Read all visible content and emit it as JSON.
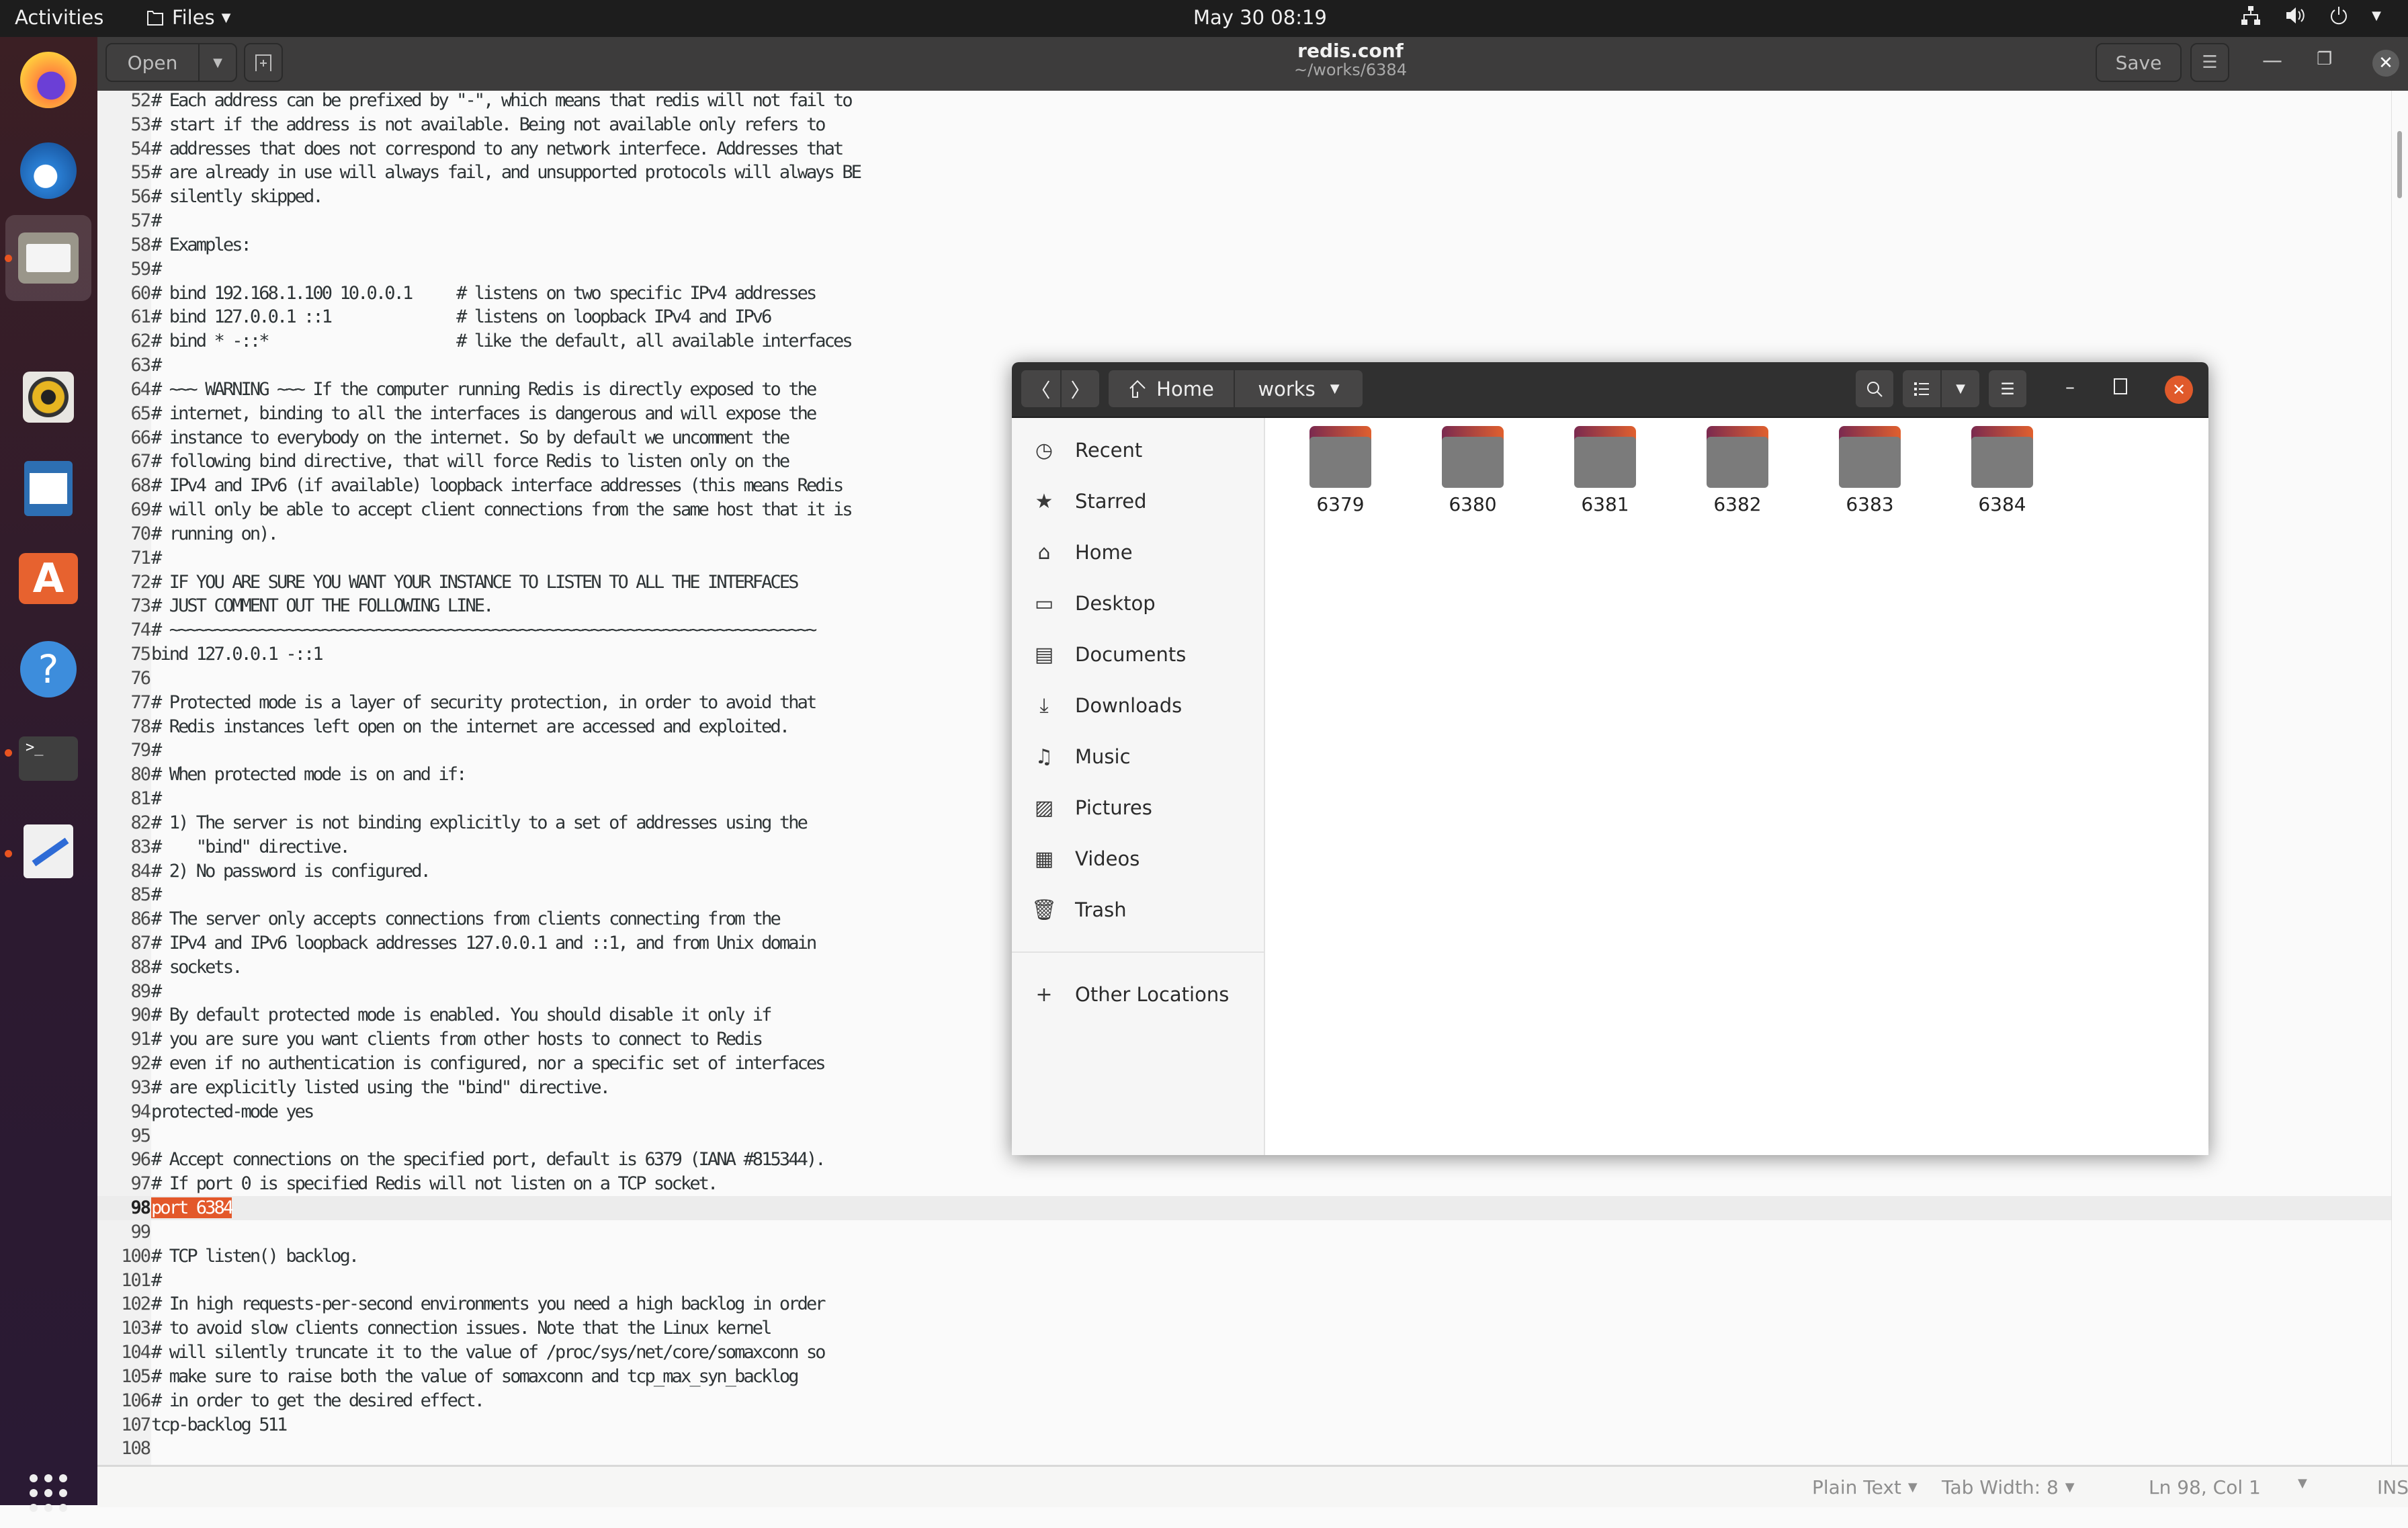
{
  "topbar": {
    "activities": "Activities",
    "app_menu": "Files",
    "clock": "May 30  08:19",
    "tray_icons": [
      "network-icon",
      "volume-icon",
      "power-icon",
      "system-menu-caret"
    ]
  },
  "dock": {
    "apps": [
      {
        "name": "Firefox",
        "icon": "firefox-icon",
        "running": false
      },
      {
        "name": "Thunderbird",
        "icon": "thunderbird-icon",
        "running": false
      },
      {
        "name": "Files",
        "icon": "files-icon",
        "running": true,
        "active": true
      },
      {
        "name": "Rhythmbox",
        "icon": "rhythmbox-icon",
        "running": false
      },
      {
        "name": "LibreOffice Writer",
        "icon": "writer-icon",
        "running": false
      },
      {
        "name": "Ubuntu Software",
        "icon": "software-icon",
        "running": false
      },
      {
        "name": "Help",
        "icon": "help-icon",
        "running": false
      },
      {
        "name": "Terminal",
        "icon": "terminal-icon",
        "running": true
      },
      {
        "name": "Text Editor",
        "icon": "text-editor-icon",
        "running": true
      }
    ],
    "show_apps": "show-applications-icon"
  },
  "gedit": {
    "open_label": "Open",
    "save_label": "Save",
    "title": "redis.conf",
    "subtitle": "~/works/6384",
    "current_line": 98,
    "selected_text": "port 6384",
    "lines": [
      {
        "n": "52",
        "t": "# Each address can be prefixed by \"-\", which means that redis will not fail to"
      },
      {
        "n": "53",
        "t": "# start if the address is not available. Being not available only refers to"
      },
      {
        "n": "54",
        "t": "# addresses that does not correspond to any network interfece. Addresses that"
      },
      {
        "n": "55",
        "t": "# are already in use will always fail, and unsupported protocols will always BE"
      },
      {
        "n": "56",
        "t": "# silently skipped."
      },
      {
        "n": "57",
        "t": "#"
      },
      {
        "n": "58",
        "t": "# Examples:"
      },
      {
        "n": "59",
        "t": "#"
      },
      {
        "n": "60",
        "t": "# bind 192.168.1.100 10.0.0.1     # listens on two specific IPv4 addresses"
      },
      {
        "n": "61",
        "t": "# bind 127.0.0.1 ::1              # listens on loopback IPv4 and IPv6"
      },
      {
        "n": "62",
        "t": "# bind * -::*                     # like the default, all available interfaces"
      },
      {
        "n": "63",
        "t": "#"
      },
      {
        "n": "64",
        "t": "# ~~~ WARNING ~~~ If the computer running Redis is directly exposed to the"
      },
      {
        "n": "65",
        "t": "# internet, binding to all the interfaces is dangerous and will expose the"
      },
      {
        "n": "66",
        "t": "# instance to everybody on the internet. So by default we uncomment the"
      },
      {
        "n": "67",
        "t": "# following bind directive, that will force Redis to listen only on the"
      },
      {
        "n": "68",
        "t": "# IPv4 and IPv6 (if available) loopback interface addresses (this means Redis"
      },
      {
        "n": "69",
        "t": "# will only be able to accept client connections from the same host that it is"
      },
      {
        "n": "70",
        "t": "# running on)."
      },
      {
        "n": "71",
        "t": "#"
      },
      {
        "n": "72",
        "t": "# IF YOU ARE SURE YOU WANT YOUR INSTANCE TO LISTEN TO ALL THE INTERFACES"
      },
      {
        "n": "73",
        "t": "# JUST COMMENT OUT THE FOLLOWING LINE."
      },
      {
        "n": "74",
        "t": "# ~~~~~~~~~~~~~~~~~~~~~~~~~~~~~~~~~~~~~~~~~~~~~~~~~~~~~~~~~~~~~~~~~~~~~~~~"
      },
      {
        "n": "75",
        "t": "bind 127.0.0.1 -::1"
      },
      {
        "n": "76",
        "t": ""
      },
      {
        "n": "77",
        "t": "# Protected mode is a layer of security protection, in order to avoid that"
      },
      {
        "n": "78",
        "t": "# Redis instances left open on the internet are accessed and exploited."
      },
      {
        "n": "79",
        "t": "#"
      },
      {
        "n": "80",
        "t": "# When protected mode is on and if:"
      },
      {
        "n": "81",
        "t": "#"
      },
      {
        "n": "82",
        "t": "# 1) The server is not binding explicitly to a set of addresses using the"
      },
      {
        "n": "83",
        "t": "#    \"bind\" directive."
      },
      {
        "n": "84",
        "t": "# 2) No password is configured."
      },
      {
        "n": "85",
        "t": "#"
      },
      {
        "n": "86",
        "t": "# The server only accepts connections from clients connecting from the"
      },
      {
        "n": "87",
        "t": "# IPv4 and IPv6 loopback addresses 127.0.0.1 and ::1, and from Unix domain"
      },
      {
        "n": "88",
        "t": "# sockets."
      },
      {
        "n": "89",
        "t": "#"
      },
      {
        "n": "90",
        "t": "# By default protected mode is enabled. You should disable it only if"
      },
      {
        "n": "91",
        "t": "# you are sure you want clients from other hosts to connect to Redis"
      },
      {
        "n": "92",
        "t": "# even if no authentication is configured, nor a specific set of interfaces"
      },
      {
        "n": "93",
        "t": "# are explicitly listed using the \"bind\" directive."
      },
      {
        "n": "94",
        "t": "protected-mode yes"
      },
      {
        "n": "95",
        "t": ""
      },
      {
        "n": "96",
        "t": "# Accept connections on the specified port, default is 6379 (IANA #815344)."
      },
      {
        "n": "97",
        "t": "# If port 0 is specified Redis will not listen on a TCP socket."
      },
      {
        "n": "98",
        "t": "port 6384"
      },
      {
        "n": "99",
        "t": ""
      },
      {
        "n": "100",
        "t": "# TCP listen() backlog."
      },
      {
        "n": "101",
        "t": "#"
      },
      {
        "n": "102",
        "t": "# In high requests-per-second environments you need a high backlog in order"
      },
      {
        "n": "103",
        "t": "# to avoid slow clients connection issues. Note that the Linux kernel"
      },
      {
        "n": "104",
        "t": "# will silently truncate it to the value of /proc/sys/net/core/somaxconn so"
      },
      {
        "n": "105",
        "t": "# make sure to raise both the value of somaxconn and tcp_max_syn_backlog"
      },
      {
        "n": "106",
        "t": "# in order to get the desired effect."
      },
      {
        "n": "107",
        "t": "tcp-backlog 511"
      },
      {
        "n": "108",
        "t": ""
      }
    ],
    "status": {
      "language": "Plain Text",
      "tab_width": "Tab Width: 8",
      "position": "Ln 98, Col 1",
      "mode": "INS"
    }
  },
  "files": {
    "path": [
      "Home",
      "works"
    ],
    "sidebar": [
      {
        "label": "Recent",
        "icon": "recent-icon"
      },
      {
        "label": "Starred",
        "icon": "star-icon"
      },
      {
        "label": "Home",
        "icon": "home-icon"
      },
      {
        "label": "Desktop",
        "icon": "desktop-icon"
      },
      {
        "label": "Documents",
        "icon": "documents-icon"
      },
      {
        "label": "Downloads",
        "icon": "downloads-icon"
      },
      {
        "label": "Music",
        "icon": "music-icon"
      },
      {
        "label": "Pictures",
        "icon": "pictures-icon"
      },
      {
        "label": "Videos",
        "icon": "videos-icon"
      },
      {
        "label": "Trash",
        "icon": "trash-icon"
      }
    ],
    "other_locations": "Other Locations",
    "folders": [
      "6379",
      "6380",
      "6381",
      "6382",
      "6383",
      "6384"
    ],
    "colors": {
      "folder_gradient_start": "#7a2a50",
      "folder_gradient_end": "#e0602e",
      "close_button": "#e05a2b"
    }
  },
  "colors": {
    "accent": "#e95420",
    "selection": "#e3582a",
    "topbar": "#1d1d1d",
    "header": "#3d3c3c"
  }
}
